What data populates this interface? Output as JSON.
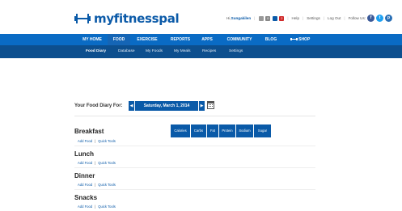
{
  "brand": {
    "name": "myfitnesspal",
    "color": "#0a5aa8"
  },
  "util_bar": {
    "greeting": "Hi, ",
    "username": "Sungakilen",
    "mail_count": "0",
    "friend_count": "2",
    "help": "Help",
    "settings": "Settings",
    "logout": "Log Out",
    "follow_us": "Follow Us:"
  },
  "primary_nav": [
    {
      "label": "MY HOME"
    },
    {
      "label": "FOOD"
    },
    {
      "label": "EXERCISE"
    },
    {
      "label": "REPORTS"
    },
    {
      "label": "APPS"
    },
    {
      "label": "COMMUNITY"
    },
    {
      "label": "BLOG"
    },
    {
      "label": "SHOP"
    }
  ],
  "secondary_nav": [
    {
      "label": "Food Diary"
    },
    {
      "label": "Database"
    },
    {
      "label": "My Foods"
    },
    {
      "label": "My Meals"
    },
    {
      "label": "Recipes"
    },
    {
      "label": "Settings"
    }
  ],
  "diary": {
    "label": "Your Food Diary For:",
    "date": "Saturday, March 1, 2014",
    "prev_arrow": "◀",
    "next_arrow": "▶"
  },
  "nutrient_columns": [
    "Calories",
    "Carbs",
    "Fat",
    "Protein",
    "Sodium",
    "Sugar"
  ],
  "meals": [
    {
      "name": "Breakfast",
      "add_food": "Add Food",
      "quick_tools": "Quick Tools"
    },
    {
      "name": "Lunch",
      "add_food": "Add Food",
      "quick_tools": "Quick Tools"
    },
    {
      "name": "Dinner",
      "add_food": "Add Food",
      "quick_tools": "Quick Tools"
    },
    {
      "name": "Snacks",
      "add_food": "Add Food",
      "quick_tools": "Quick Tools"
    }
  ],
  "colors": {
    "nav_primary": "#0a6bc4",
    "nav_secondary": "#0d4f8e",
    "accent": "#0a5aa8",
    "facebook": "#3b5998",
    "twitter": "#1da1f2",
    "pinterest": "#2a6fb5"
  }
}
